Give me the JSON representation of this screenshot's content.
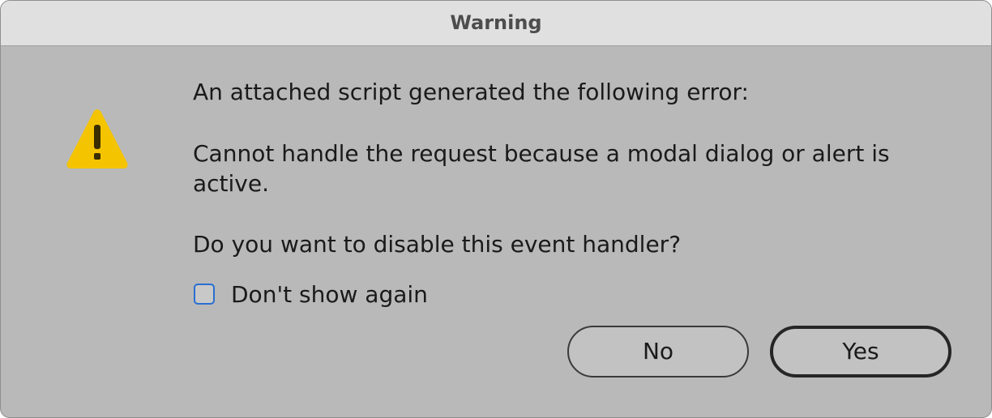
{
  "dialog": {
    "title": "Warning",
    "icon": "warning-icon",
    "message_line1": "An attached script generated the following error:",
    "message_line2": "Cannot handle the request because a modal dialog or alert is active.",
    "message_line3": "Do you want to disable this event handler?",
    "checkbox": {
      "label": "Don't show again",
      "checked": false
    },
    "buttons": {
      "no_label": "No",
      "yes_label": "Yes",
      "default": "Yes"
    }
  },
  "colors": {
    "dialog_background": "#b9b9b9",
    "titlebar_background": "#e0e0e0",
    "warning_yellow": "#f5c400",
    "checkbox_border": "#2a6ed1"
  }
}
